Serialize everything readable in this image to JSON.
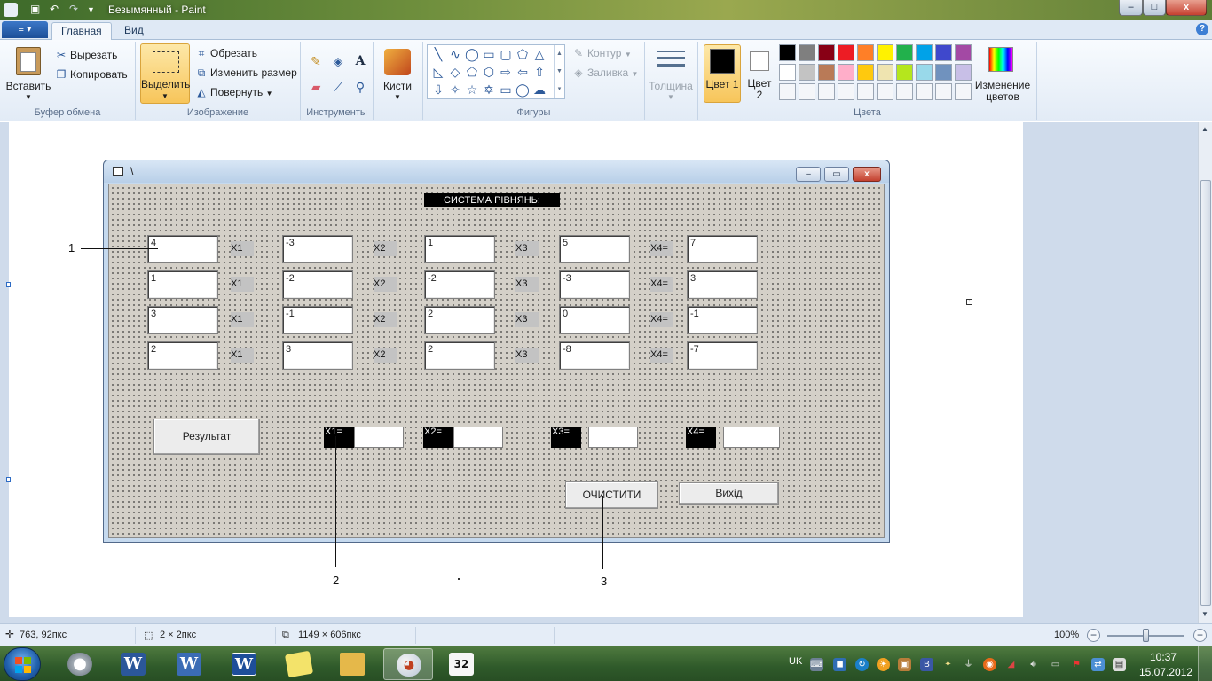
{
  "titlebar": {
    "title": "Безымянный - Paint",
    "controls": {
      "minimize": "–",
      "maximize": "□",
      "close": "x"
    }
  },
  "tabs": {
    "file_icon": "≡ ▾",
    "home": "Главная",
    "view": "Вид",
    "help": "?"
  },
  "ribbon": {
    "clipboard": {
      "label": "Буфер обмена",
      "paste": "Вставить",
      "cut": "Вырезать",
      "copy": "Копировать"
    },
    "image": {
      "label": "Изображение",
      "select": "Выделить",
      "crop": "Обрезать",
      "resize": "Изменить размер",
      "rotate": "Повернуть"
    },
    "tools": {
      "label": "Инструменты"
    },
    "brushes": {
      "label": "Кисти"
    },
    "shapes": {
      "label": "Фигуры",
      "outline": "Контур",
      "fill": "Заливка"
    },
    "size": {
      "label": "Толщина"
    },
    "colors": {
      "label": "Цвета",
      "color1": "Цвет 1",
      "color2": "Цвет 2",
      "edit": "Изменение цветов",
      "color1_value": "#000000",
      "color2_value": "#ffffff",
      "palette_row1": [
        "#000000",
        "#7f7f7f",
        "#880015",
        "#ed1c24",
        "#ff7f27",
        "#fff200",
        "#22b14c",
        "#00a2e8",
        "#3f48cc",
        "#a349a4"
      ],
      "palette_row2": [
        "#ffffff",
        "#c3c3c3",
        "#b97a57",
        "#ffaec9",
        "#ffc90e",
        "#efe4b0",
        "#b5e61d",
        "#99d9ea",
        "#7092be",
        "#c8bfe7"
      ],
      "palette_row3": [
        "#f4f6f9",
        "#f4f6f9",
        "#f4f6f9",
        "#f4f6f9",
        "#f4f6f9",
        "#f4f6f9",
        "#f4f6f9",
        "#f4f6f9",
        "#f4f6f9",
        "#f4f6f9"
      ]
    }
  },
  "form": {
    "title": "\\",
    "system_title": "СИСТЕМА РІВНЯНЬ:",
    "equations": [
      {
        "a1": "4",
        "a2": "-3",
        "a3": "1",
        "a4": "5",
        "b": "7"
      },
      {
        "a1": "1",
        "a2": "-2",
        "a3": "-2",
        "a4": "-3",
        "b": "3"
      },
      {
        "a1": "3",
        "a2": "-1",
        "a3": "2",
        "a4": "0",
        "b": "-1"
      },
      {
        "a1": "2",
        "a2": "3",
        "a3": "2",
        "a4": "-8",
        "b": "-7"
      }
    ],
    "var_labels": {
      "x1": "X1",
      "x2": "X2",
      "x3": "X3",
      "x4": "X4="
    },
    "result_labels": {
      "x1": "X1=",
      "x2": "X2=",
      "x3": "X3=",
      "x4": "X4="
    },
    "buttons": {
      "result": "Результат",
      "clear": "ОЧИСТИТИ",
      "exit": "Вихід"
    }
  },
  "callouts": {
    "one": "1",
    "two": "2",
    "three": "3"
  },
  "statusbar": {
    "cursor_pos": "763, 92пкс",
    "selection_size": "2 × 2пкс",
    "image_size": "1149 × 606пкс",
    "zoom": "100%"
  },
  "taskbar": {
    "language": "UK",
    "time": "10:37",
    "date": "15.07.2012"
  }
}
